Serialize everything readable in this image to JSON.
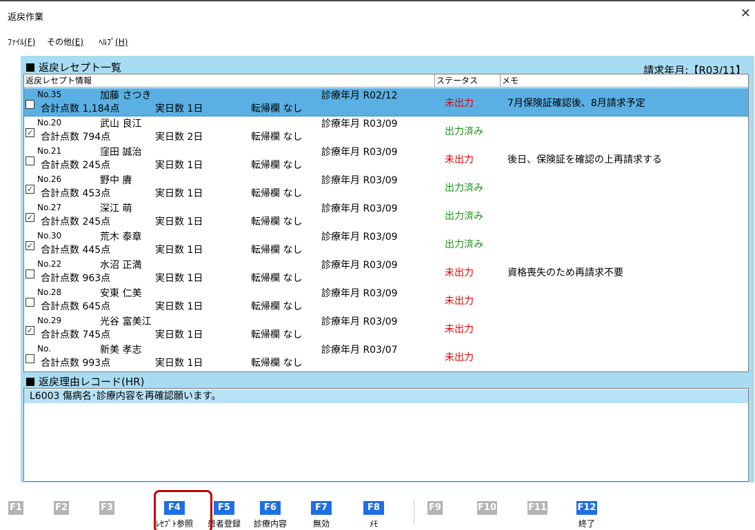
{
  "window": {
    "title": "返戻作業",
    "close_glyph": "✕"
  },
  "menu": [
    {
      "label": "ﾌｧｲﾙ",
      "key": "(F)"
    },
    {
      "label": "その他",
      "key": "(E)"
    },
    {
      "label": "ﾍﾙﾌﾟ",
      "key": "(H)"
    }
  ],
  "list": {
    "heading": "返戻レセプト一覧",
    "billing_label": "請求年月:【R03/11】",
    "columns": {
      "info": "返戻レセプト情報",
      "status": "ステータス",
      "memo": "メモ"
    },
    "field_labels": {
      "total_points": "合計点数",
      "actual_days": "実日数",
      "outcome": "転帰欄",
      "treatment_month": "診療年月"
    },
    "rows": [
      {
        "checked": false,
        "no": "No.35",
        "name": "加藤 さつき",
        "month": "R02/12",
        "points": "1,184点",
        "days": "1日",
        "outcome": "なし",
        "status": "未出力",
        "status_color": "red",
        "memo": "7月保険証確認後、8月請求予定",
        "selected": true
      },
      {
        "checked": true,
        "no": "No.20",
        "name": "武山 良江",
        "month": "R03/09",
        "points": "794点",
        "days": "2日",
        "outcome": "なし",
        "status": "出力済み",
        "status_color": "green",
        "memo": "",
        "selected": false
      },
      {
        "checked": false,
        "no": "No.21",
        "name": "窪田 誠治",
        "month": "R03/09",
        "points": "245点",
        "days": "1日",
        "outcome": "なし",
        "status": "未出力",
        "status_color": "red",
        "memo": "後日、保険証を確認の上再請求する",
        "selected": false
      },
      {
        "checked": true,
        "no": "No.26",
        "name": "野中 賡",
        "month": "R03/09",
        "points": "453点",
        "days": "1日",
        "outcome": "なし",
        "status": "出力済み",
        "status_color": "green",
        "memo": "",
        "selected": false
      },
      {
        "checked": true,
        "no": "No.27",
        "name": "深江 萌",
        "month": "R03/09",
        "points": "245点",
        "days": "1日",
        "outcome": "なし",
        "status": "出力済み",
        "status_color": "green",
        "memo": "",
        "selected": false
      },
      {
        "checked": true,
        "no": "No.30",
        "name": "荒木 泰章",
        "month": "R03/09",
        "points": "445点",
        "days": "1日",
        "outcome": "なし",
        "status": "出力済み",
        "status_color": "green",
        "memo": "",
        "selected": false
      },
      {
        "checked": false,
        "no": "No.22",
        "name": "水沼 正満",
        "month": "R03/09",
        "points": "963点",
        "days": "1日",
        "outcome": "なし",
        "status": "未出力",
        "status_color": "red",
        "memo": "資格喪失のため再請求不要",
        "selected": false
      },
      {
        "checked": false,
        "no": "No.28",
        "name": "安東 仁美",
        "month": "R03/09",
        "points": "645点",
        "days": "1日",
        "outcome": "なし",
        "status": "未出力",
        "status_color": "red",
        "memo": "",
        "selected": false
      },
      {
        "checked": true,
        "no": "No.29",
        "name": "光谷 富美江",
        "month": "R03/09",
        "points": "745点",
        "days": "1日",
        "outcome": "なし",
        "status": "未出力",
        "status_color": "red",
        "memo": "",
        "selected": false
      },
      {
        "checked": false,
        "no": "No.",
        "name": "新美 孝志",
        "month": "R03/07",
        "points": "993点",
        "days": "1日",
        "outcome": "なし",
        "status": "未出力",
        "status_color": "red",
        "memo": "",
        "selected": false
      }
    ]
  },
  "hr": {
    "heading": "返戻理由レコード(HR)",
    "lines": [
      "L6003 傷病名･診療内容を再確認願います。"
    ]
  },
  "fkeys": [
    {
      "key": "F1",
      "label": "",
      "enabled": false
    },
    {
      "key": "F2",
      "label": "",
      "enabled": false
    },
    {
      "key": "F3",
      "label": "",
      "enabled": false
    },
    {
      "key": "F4",
      "label": "ﾚｾﾌﾟﾄ参照",
      "enabled": true
    },
    {
      "key": "F5",
      "label": "患者登録",
      "enabled": true
    },
    {
      "key": "F6",
      "label": "診療内容",
      "enabled": true
    },
    {
      "key": "F7",
      "label": "無効",
      "enabled": true
    },
    {
      "key": "F8",
      "label": "ﾒﾓ",
      "enabled": true
    },
    {
      "key": "F9",
      "label": "",
      "enabled": false
    },
    {
      "key": "F10",
      "label": "",
      "enabled": false
    },
    {
      "key": "F11",
      "label": "",
      "enabled": false
    },
    {
      "key": "F12",
      "label": "終了",
      "enabled": true
    }
  ],
  "colors": {
    "panel_bg": "#a8dcf2",
    "selected_row": "#5ab0e3",
    "status_red": "#e60000",
    "status_green": "#189218",
    "fkey_enabled": "#1f6fe5",
    "fkey_disabled": "#b4b4b4",
    "highlight_box": "#c00000"
  }
}
